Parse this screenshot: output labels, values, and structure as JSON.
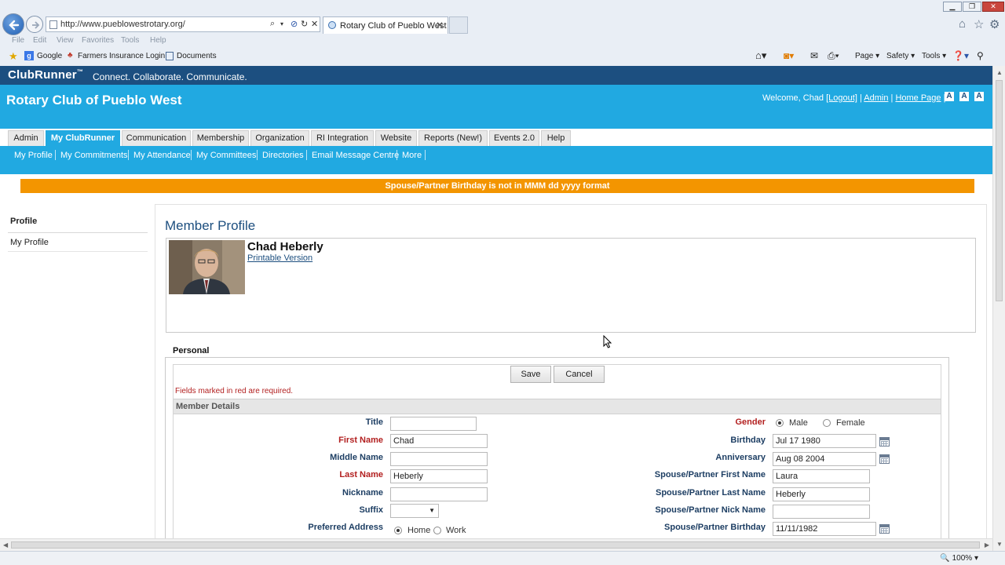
{
  "browser": {
    "url": "http://www.pueblowestrotary.org/",
    "tab_title": "Rotary Club of Pueblo West",
    "menu": [
      "File",
      "Edit",
      "View",
      "Favorites",
      "Tools",
      "Help"
    ],
    "favorites": [
      "Google",
      "Farmers Insurance Login",
      "Documents"
    ],
    "command_bar": [
      "Page",
      "Safety",
      "Tools"
    ],
    "zoom": "100%"
  },
  "clubrunner": {
    "logo": "ClubRunner",
    "trademark": "™",
    "tagline": "Connect. Collaborate. Communicate."
  },
  "header": {
    "club_name": "Rotary Club of Pueblo West",
    "welcome_prefix": "Welcome, Chad",
    "logout": "[Logout]",
    "admin": "Admin",
    "home_page": "Home Page",
    "font_sizes": [
      "A",
      "A",
      "A"
    ]
  },
  "main_nav": [
    {
      "label": "Admin"
    },
    {
      "label": "My ClubRunner",
      "active": true
    },
    {
      "label": "Communication"
    },
    {
      "label": "Membership"
    },
    {
      "label": "Organization"
    },
    {
      "label": "RI Integration"
    },
    {
      "label": "Website"
    },
    {
      "label": "Reports (New!)"
    },
    {
      "label": "Events 2.0"
    },
    {
      "label": "Help"
    }
  ],
  "sub_nav": [
    {
      "label": "My Profile"
    },
    {
      "label": "My Commitments"
    },
    {
      "label": "My Attendance"
    },
    {
      "label": "My Committees"
    },
    {
      "label": "Directories"
    },
    {
      "label": "Email Message Centre"
    },
    {
      "label": "More"
    }
  ],
  "alert": "Spouse/Partner Birthday is not in MMM dd yyyy format",
  "sidebar": {
    "title": "Profile",
    "items": [
      "My Profile"
    ]
  },
  "profile": {
    "page_title": "Member Profile",
    "name": "Chad Heberly",
    "printable": "Printable Version"
  },
  "form": {
    "section_label": "Personal",
    "save": "Save",
    "cancel": "Cancel",
    "required_note": "Fields marked in red are required.",
    "section_title": "Member Details",
    "title_label": "Title",
    "title_value": "",
    "first_name_label": "First Name",
    "first_name_value": "Chad",
    "middle_name_label": "Middle Name",
    "middle_name_value": "",
    "last_name_label": "Last Name",
    "last_name_value": "Heberly",
    "nickname_label": "Nickname",
    "nickname_value": "",
    "suffix_label": "Suffix",
    "suffix_value": "",
    "preferred_address_label": "Preferred Address",
    "preferred_address_options": [
      "Home",
      "Work"
    ],
    "preferred_address_selected": "Home",
    "gender_label": "Gender",
    "gender_options": [
      "Male",
      "Female"
    ],
    "gender_selected": "Male",
    "birthday_label": "Birthday",
    "birthday_value": "Jul 17 1980",
    "anniversary_label": "Anniversary",
    "anniversary_value": "Aug 08 2004",
    "spouse_first_label": "Spouse/Partner First Name",
    "spouse_first_value": "Laura",
    "spouse_last_label": "Spouse/Partner Last Name",
    "spouse_last_value": "Heberly",
    "spouse_nick_label": "Spouse/Partner Nick Name",
    "spouse_nick_value": "",
    "spouse_birthday_label": "Spouse/Partner Birthday",
    "spouse_birthday_value": "11/11/1982"
  },
  "colors": {
    "clubrunner_bar": "#1c4f80",
    "header_blue": "#21a9e1",
    "alert_orange": "#f39500",
    "required_red": "#b21f1f",
    "label_navy": "#1d3e63"
  }
}
